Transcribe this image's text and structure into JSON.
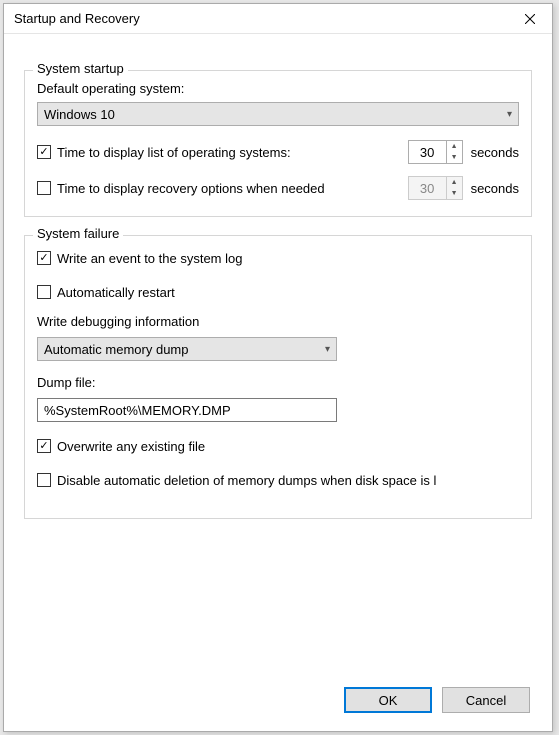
{
  "title": "Startup and Recovery",
  "system_startup": {
    "group_label": "System startup",
    "default_os_label": "Default operating system:",
    "default_os_value": "Windows 10",
    "display_list_label": "Time to display list of operating systems:",
    "display_list_value": "30",
    "display_list_checked": true,
    "display_recovery_label": "Time to display recovery options when needed",
    "display_recovery_value": "30",
    "display_recovery_checked": false,
    "unit": "seconds"
  },
  "system_failure": {
    "group_label": "System failure",
    "write_event_label": "Write an event to the system log",
    "write_event_checked": true,
    "auto_restart_label": "Automatically restart",
    "auto_restart_checked": false,
    "debug_info_label": "Write debugging information",
    "debug_type_value": "Automatic memory dump",
    "dump_file_label": "Dump file:",
    "dump_file_value": "%SystemRoot%\\MEMORY.DMP",
    "overwrite_label": "Overwrite any existing file",
    "overwrite_checked": true,
    "disable_delete_label": "Disable automatic deletion of memory dumps when disk space is l",
    "disable_delete_checked": false
  },
  "buttons": {
    "ok": "OK",
    "cancel": "Cancel"
  }
}
